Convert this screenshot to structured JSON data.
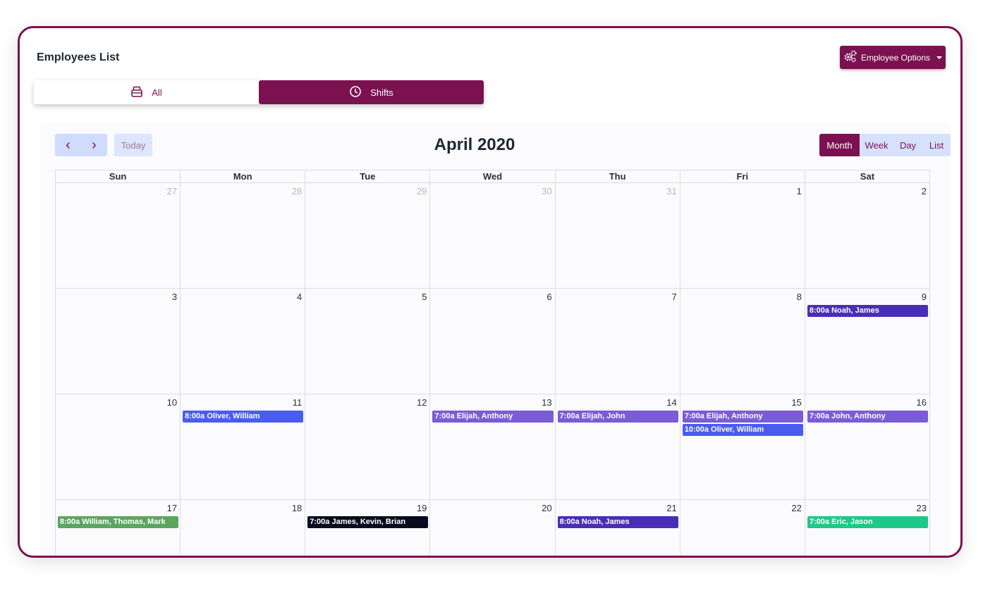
{
  "header": {
    "title": "Employees List",
    "options_label": "Employee Options"
  },
  "tabs": [
    {
      "label": "All"
    },
    {
      "label": "Shifts"
    }
  ],
  "toolbar": {
    "prev": "‹",
    "next": "›",
    "today": "Today",
    "title": "April 2020"
  },
  "modes": [
    {
      "label": "Month"
    },
    {
      "label": "Week"
    },
    {
      "label": "Day"
    },
    {
      "label": "List"
    }
  ],
  "days_of_week": [
    "Sun",
    "Mon",
    "Tue",
    "Wed",
    "Thu",
    "Fri",
    "Sat"
  ],
  "weeks": [
    [
      {
        "n": "27",
        "other": true,
        "events": []
      },
      {
        "n": "28",
        "other": true,
        "events": []
      },
      {
        "n": "29",
        "other": true,
        "events": []
      },
      {
        "n": "30",
        "other": true,
        "events": []
      },
      {
        "n": "31",
        "other": true,
        "events": []
      },
      {
        "n": "1",
        "events": []
      },
      {
        "n": "2",
        "events": []
      }
    ],
    [
      {
        "n": "3",
        "events": []
      },
      {
        "n": "4",
        "events": []
      },
      {
        "n": "5",
        "events": []
      },
      {
        "n": "6",
        "events": []
      },
      {
        "n": "7",
        "events": []
      },
      {
        "n": "8",
        "events": []
      },
      {
        "n": "9",
        "events": [
          {
            "time": "8:00a",
            "text": "Noah, James",
            "color": "#4a2db5"
          }
        ]
      }
    ],
    [
      {
        "n": "10",
        "events": []
      },
      {
        "n": "11",
        "events": [
          {
            "time": "8:00a",
            "text": "Oliver, William",
            "color": "#4a5cf0"
          }
        ]
      },
      {
        "n": "12",
        "events": []
      },
      {
        "n": "13",
        "events": [
          {
            "time": "7:00a",
            "text": "Elijah, Anthony",
            "color": "#7b5cd6"
          }
        ]
      },
      {
        "n": "14",
        "events": [
          {
            "time": "7:00a",
            "text": "Elijah, John",
            "color": "#7b5cd6"
          }
        ]
      },
      {
        "n": "15",
        "events": [
          {
            "time": "7:00a",
            "text": "Elijah, Anthony",
            "color": "#7b5cd6"
          },
          {
            "time": "10:00a",
            "text": "Oliver, William",
            "color": "#4a5cf0"
          }
        ]
      },
      {
        "n": "16",
        "events": [
          {
            "time": "7:00a",
            "text": "John, Anthony",
            "color": "#7b5cd6"
          }
        ]
      }
    ],
    [
      {
        "n": "17",
        "events": [
          {
            "time": "8:00a",
            "text": "William, Thomas, Mark",
            "color": "#5ba55f"
          }
        ]
      },
      {
        "n": "18",
        "events": []
      },
      {
        "n": "19",
        "events": [
          {
            "time": "7:00a",
            "text": "James, Kevin, Brian",
            "color": "#0a0a1e"
          }
        ]
      },
      {
        "n": "20",
        "events": []
      },
      {
        "n": "21",
        "events": [
          {
            "time": "8:00a",
            "text": "Noah, James",
            "color": "#4a2db5"
          }
        ]
      },
      {
        "n": "22",
        "events": []
      },
      {
        "n": "23",
        "events": [
          {
            "time": "7:00a",
            "text": "Eric, Jason",
            "color": "#1ec88a"
          }
        ]
      }
    ]
  ],
  "colors": {
    "brand": "#7b1150"
  }
}
